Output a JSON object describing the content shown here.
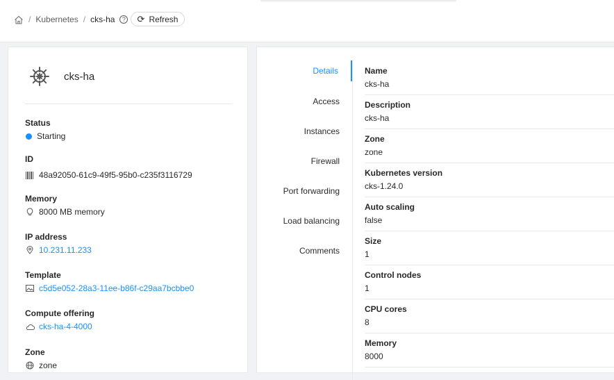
{
  "breadcrumb": {
    "items": [
      "Kubernetes",
      "cks-ha"
    ],
    "separator": "/"
  },
  "toolbar": {
    "refresh_label": "Refresh"
  },
  "resource": {
    "name": "cks-ha",
    "icon": "kubernetes-helm-icon",
    "fields": {
      "status": {
        "label": "Status",
        "value": "Starting",
        "color": "#1890ff"
      },
      "id": {
        "label": "ID",
        "value": "48a92050-61c9-49f5-95b0-c235f3116729",
        "icon": "barcode-icon"
      },
      "memory": {
        "label": "Memory",
        "value": "8000 MB memory",
        "icon": "bulb-icon"
      },
      "ip": {
        "label": "IP address",
        "value": "10.231.11.233",
        "icon": "location-pin-icon"
      },
      "template": {
        "label": "Template",
        "value": "c5d5e052-28a3-11ee-b86f-c29aa7bcbbe0",
        "icon": "picture-icon"
      },
      "offering": {
        "label": "Compute offering",
        "value": "cks-ha-4-4000",
        "icon": "cloud-icon"
      },
      "zone": {
        "label": "Zone",
        "value": "zone",
        "icon": "globe-icon"
      }
    }
  },
  "tabs": [
    "Details",
    "Access",
    "Instances",
    "Firewall",
    "Port forwarding",
    "Load balancing",
    "Comments"
  ],
  "active_tab": "Details",
  "details": [
    {
      "label": "Name",
      "value": "cks-ha"
    },
    {
      "label": "Description",
      "value": "cks-ha"
    },
    {
      "label": "Zone",
      "value": "zone"
    },
    {
      "label": "Kubernetes version",
      "value": "cks-1.24.0"
    },
    {
      "label": "Auto scaling",
      "value": "false"
    },
    {
      "label": "Size",
      "value": "1"
    },
    {
      "label": "Control nodes",
      "value": "1"
    },
    {
      "label": "CPU cores",
      "value": "8"
    },
    {
      "label": "Memory",
      "value": "8000"
    }
  ],
  "colors": {
    "accent": "#1890ff",
    "border": "#e8e8e8",
    "background": "#f0f2f5"
  }
}
